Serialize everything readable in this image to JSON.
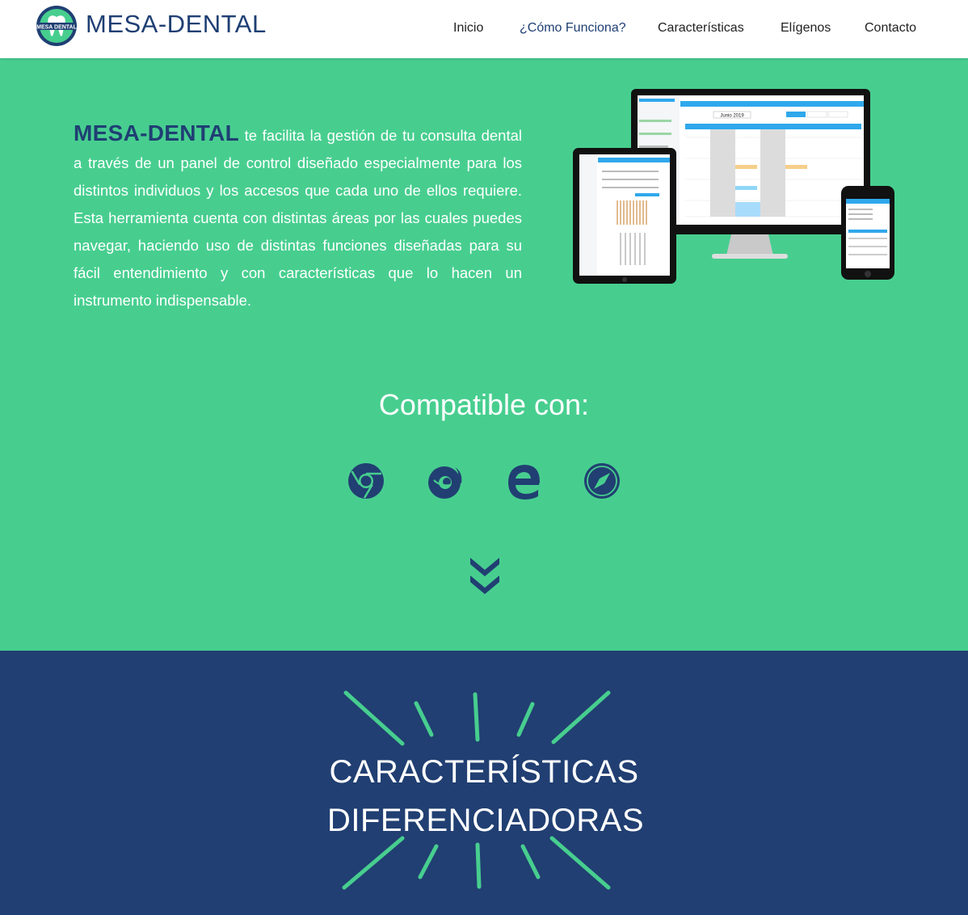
{
  "header": {
    "brand": "MESA-DENTAL",
    "logo_text": "MESA DENTAL",
    "nav": [
      {
        "label": "Inicio",
        "active": false
      },
      {
        "label": "¿Cómo Funciona?",
        "active": true
      },
      {
        "label": "Características",
        "active": false
      },
      {
        "label": "Elígenos",
        "active": false
      },
      {
        "label": "Contacto",
        "active": false
      }
    ]
  },
  "hero": {
    "highlight": "MESA-DENTAL",
    "text": " te facilita la gestión de tu consulta dental a través de un panel de control diseñado especialmente para los distintos individuos y los accesos que cada uno de ellos requiere. Esta herramienta cuenta con distintas áreas por las cuales puedes navegar, haciendo uso de distintas funciones diseñadas para su fácil entendimiento y con características que lo hacen un instrumento indispensable.",
    "mockup_calendar_month": "Junio 2019",
    "compatible_title": "Compatible con:",
    "browsers": [
      "chrome-icon",
      "firefox-icon",
      "edge-icon",
      "safari-icon"
    ]
  },
  "features": {
    "line1": "CARACTERÍSTICAS",
    "line2": "DIFERENCIADORAS"
  },
  "colors": {
    "green": "#47ce8f",
    "navy": "#213f72",
    "brand_blue": "#1f3f73",
    "ui_blue": "#2fa8ec"
  }
}
